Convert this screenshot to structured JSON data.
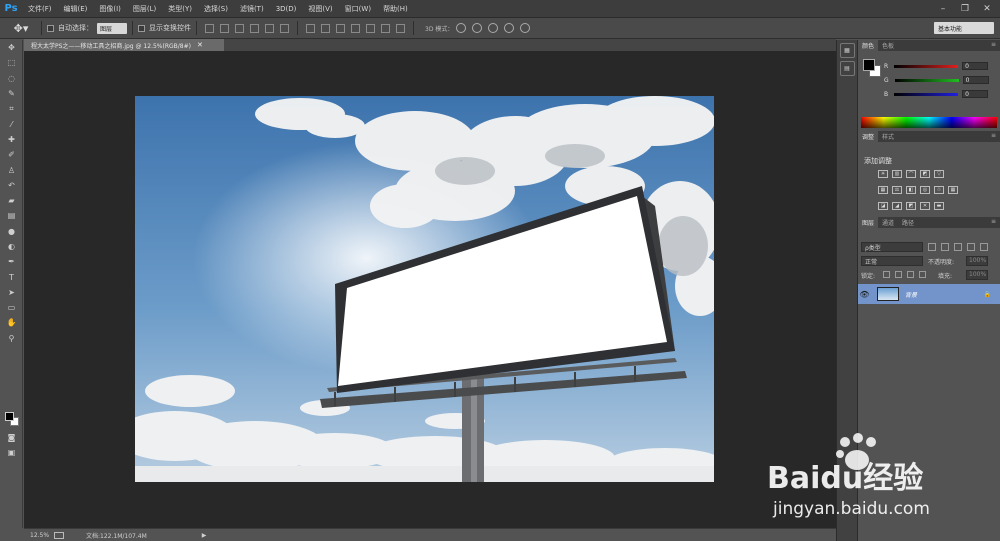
{
  "app": {
    "logo": "Ps"
  },
  "menu": [
    "文件(F)",
    "编辑(E)",
    "图像(I)",
    "图层(L)",
    "类型(Y)",
    "选择(S)",
    "滤镜(T)",
    "3D(D)",
    "视图(V)",
    "窗口(W)",
    "帮助(H)"
  ],
  "window_controls": {
    "minimize": "–",
    "restore": "❐",
    "close": "✕"
  },
  "options_bar": {
    "auto_select_label": "自动选择：",
    "auto_select_value": "图层",
    "show_transform_label": "显示变换控件",
    "mode_3d_label": "3D 模式：",
    "workspace": "基本功能"
  },
  "document": {
    "tab_title": "程大太学PS之——移动工具之招商.jpg @ 12.5%(RGB/8#)",
    "close": "✕"
  },
  "status": {
    "zoom": "12.5%",
    "doc_info": "文档:122.1M/107.4M",
    "arrow": "▶"
  },
  "panels": {
    "color": {
      "tabs": [
        "颜色",
        "色板"
      ],
      "sliders": [
        {
          "label": "R",
          "value": "0",
          "color": "#e02020"
        },
        {
          "label": "G",
          "value": "0",
          "color": "#20c020"
        },
        {
          "label": "B",
          "value": "0",
          "color": "#2020e0"
        }
      ]
    },
    "adjustments": {
      "tabs": [
        "调整",
        "样式"
      ],
      "title": "添加调整"
    },
    "layers": {
      "tabs": [
        "图层",
        "通道",
        "路径"
      ],
      "filter": "ρ类型",
      "blend_mode": "正常",
      "opacity_label": "不透明度:",
      "opacity_value": "100%",
      "lock_label": "锁定:",
      "fill_label": "填充:",
      "fill_value": "100%",
      "layer_name": "背景",
      "eye": "👁",
      "lock": "🔒"
    }
  },
  "watermark": {
    "brand": "Baidu经验",
    "url": "jingyan.baidu.com"
  },
  "menu_icon": "≡"
}
